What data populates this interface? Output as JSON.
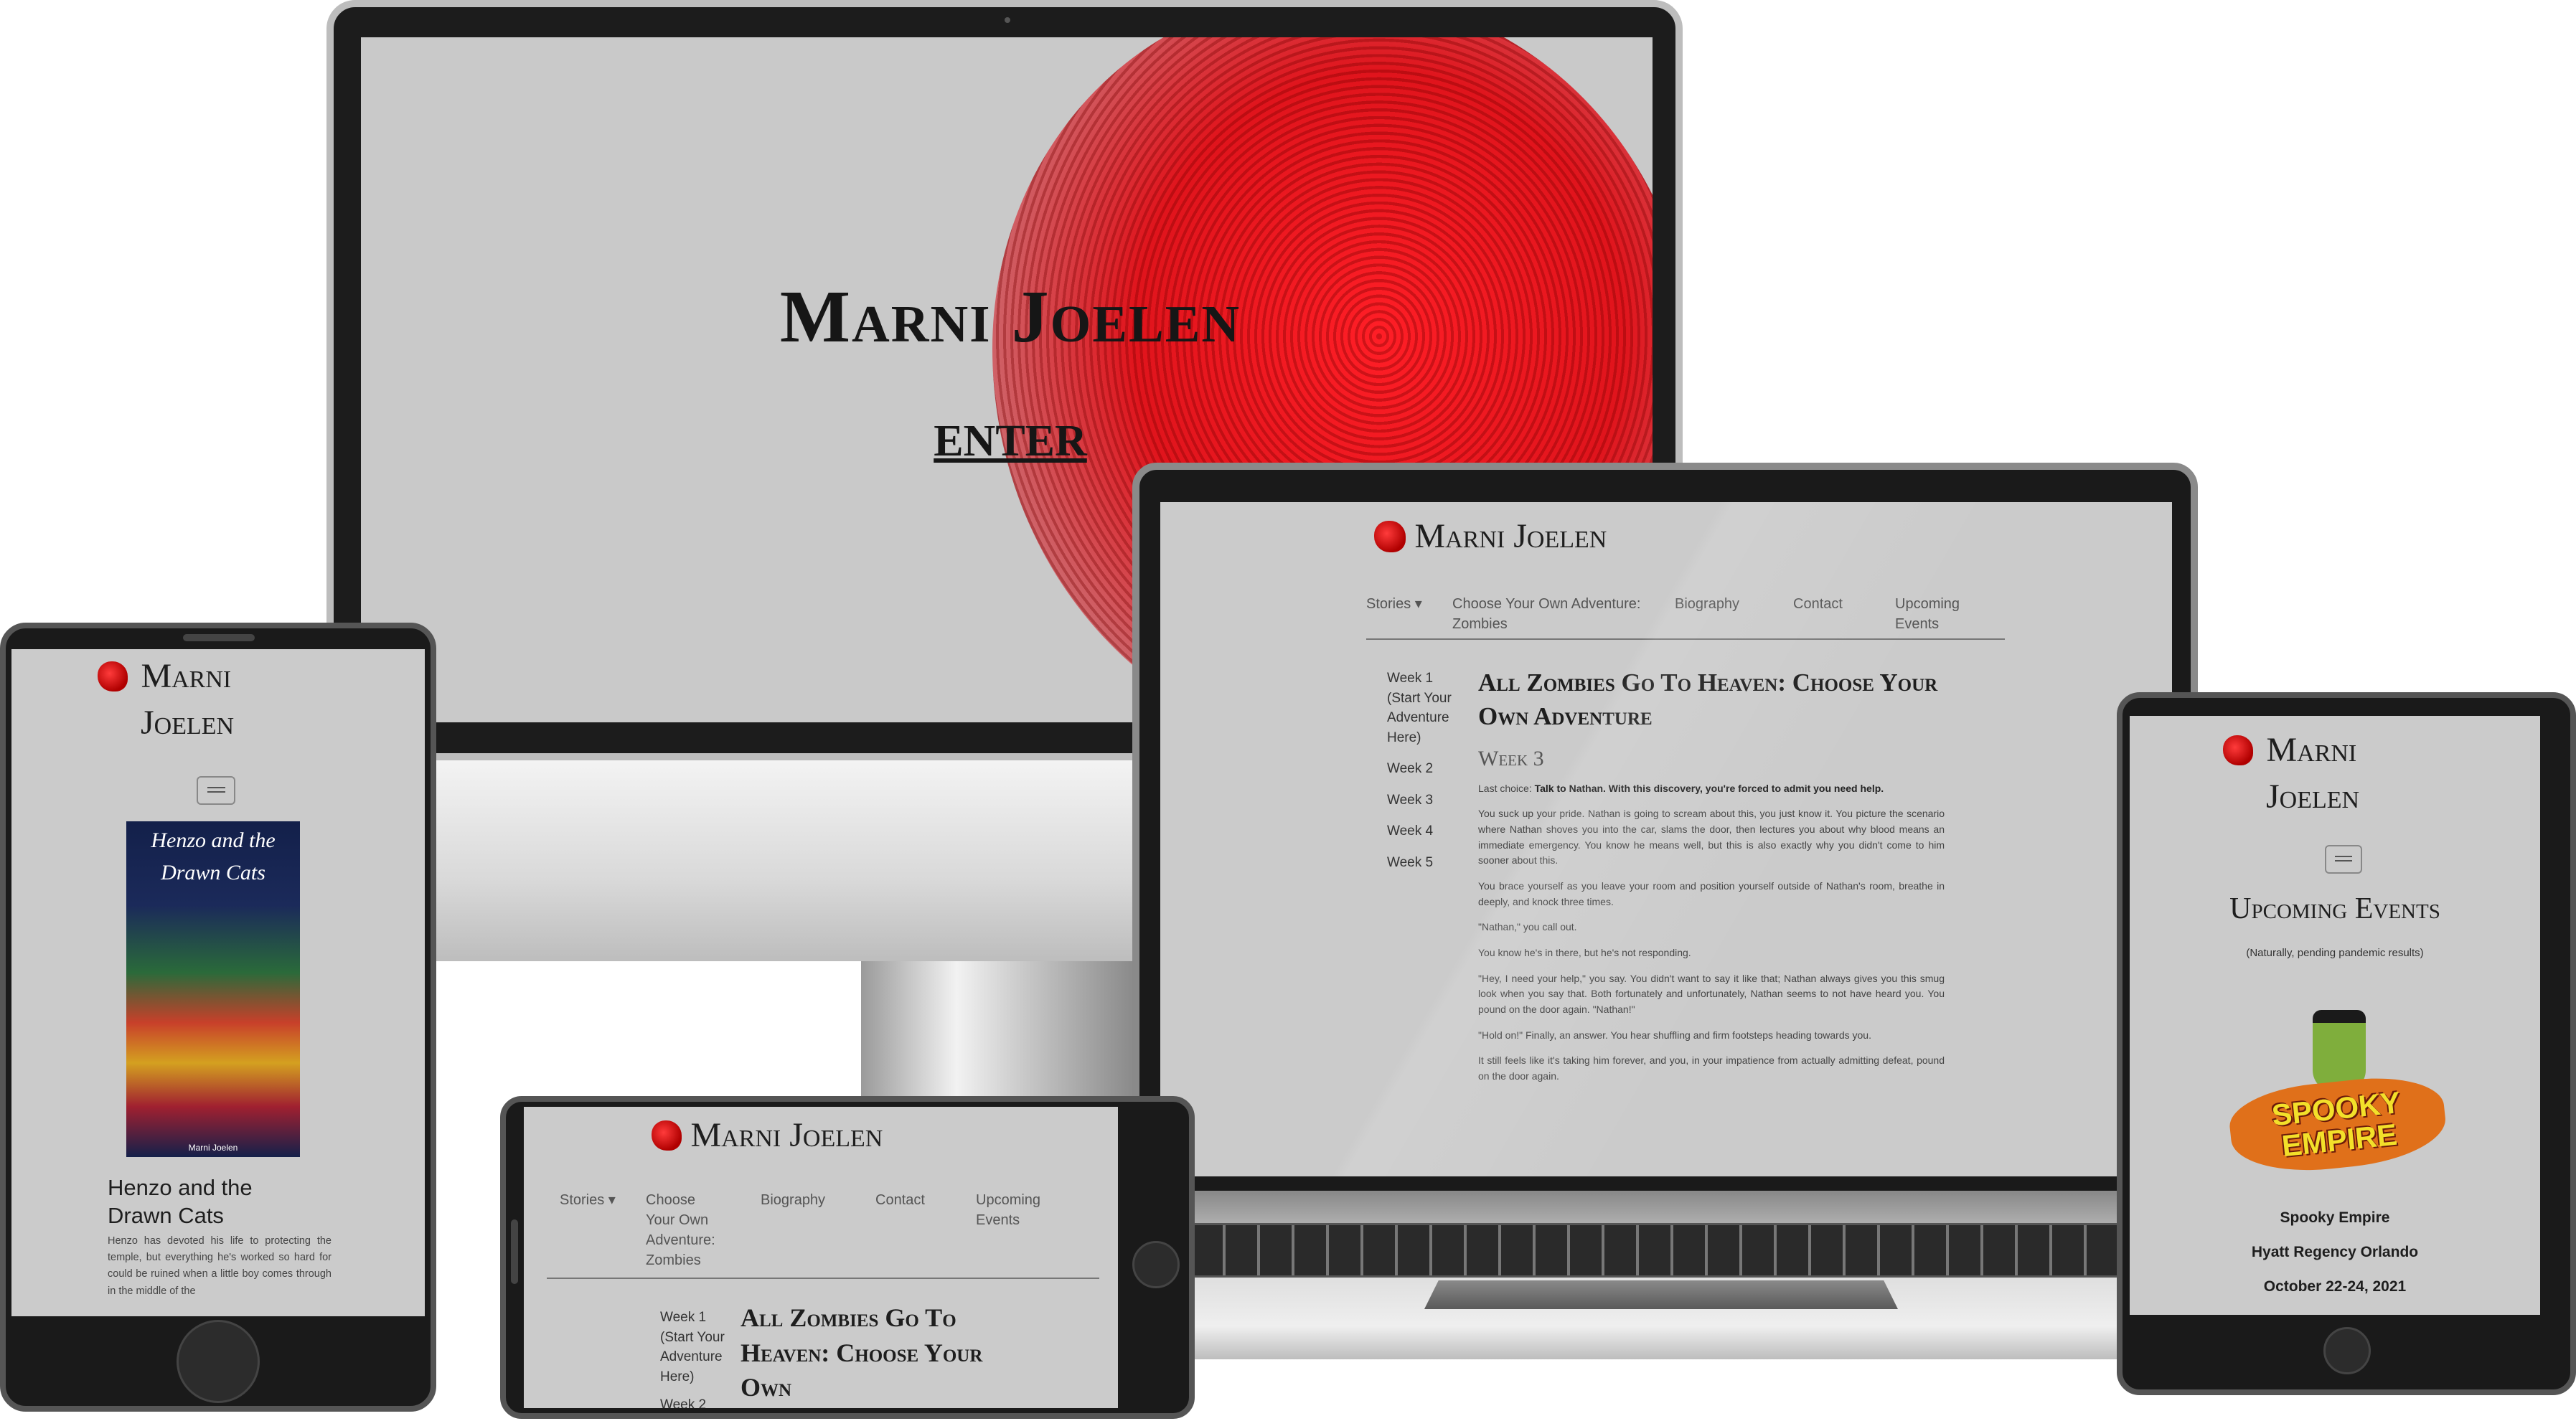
{
  "colors": {
    "screen_bg": "#cbcbcb",
    "fingerprint": "#e8141c",
    "text": "#222222",
    "nav_text": "#555555"
  },
  "desktop": {
    "title": "Marni Joelen",
    "enter_link": "ENTER"
  },
  "laptop": {
    "brand": "Marni Joelen",
    "nav": [
      "Stories ▾",
      "Choose Your Own Adventure: Zombies",
      "Biography",
      "Contact",
      "Upcoming Events"
    ],
    "sidebar": [
      "Week 1 (Start Your Adventure Here)",
      "Week 2",
      "Week 3",
      "Week 4",
      "Week 5"
    ],
    "article_title": "All Zombies Go To Heaven: Choose Your Own Adventure",
    "week_heading": "Week 3",
    "last_choice_label": "Last choice:",
    "last_choice_text": "Talk to Nathan. With this discovery, you're forced to admit you need help.",
    "paragraphs": [
      "You suck up your pride. Nathan is going to scream about this, you just know it. You picture the scenario where Nathan shoves you into the car, slams the door, then lectures you about why blood means an immediate emergency. You know he means well, but this is also exactly why you didn't come to him sooner about this.",
      "You brace yourself as you leave your room and position yourself outside of Nathan's room, breathe in deeply, and knock three times.",
      "\"Nathan,\" you call out.",
      "You know he's in there, but he's not responding.",
      "\"Hey, I need your help,\" you say. You didn't want to say it like that; Nathan always gives you this smug look when you say that. Both fortunately and unfortunately, Nathan seems to not have heard you. You pound on the door again. \"Nathan!\"",
      "\"Hold on!\" Finally, an answer. You hear shuffling and firm footsteps heading towards you.",
      "It still feels like it's taking him forever, and you, in your impatience from actually admitting defeat, pound on the door again."
    ]
  },
  "phone_portrait": {
    "brand_line1": "Marni",
    "brand_line2": "Joelen",
    "book_cover_title": "Henzo and the Drawn Cats",
    "book_cover_author": "Marni Joelen",
    "book_title": "Henzo and the Drawn Cats",
    "book_blurb": "Henzo has devoted his life to protecting the temple, but everything he's worked so hard for could be ruined when a little boy comes through in the middle of the"
  },
  "phone_landscape": {
    "brand": "Marni Joelen",
    "nav": [
      "Stories ▾",
      "Choose Your Own Adventure: Zombies",
      "Biography",
      "Contact",
      "Upcoming Events"
    ],
    "sidebar": [
      "Week 1 (Start Your Adventure Here)",
      "Week 2"
    ],
    "article_title": "All Zombies Go To Heaven: Choose Your Own"
  },
  "tablet": {
    "brand_line1": "Marni",
    "brand_line2": "Joelen",
    "heading": "Upcoming Events",
    "subheading": "(Naturally, pending pandemic results)",
    "event_logo_text": "SPOOKY EMPIRE",
    "event_name": "Spooky Empire",
    "event_venue": "Hyatt Regency Orlando",
    "event_dates": "October 22-24, 2021"
  }
}
